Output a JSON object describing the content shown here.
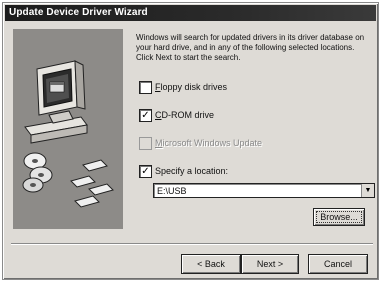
{
  "window": {
    "title": "Update Device Driver Wizard"
  },
  "intro_text": "Windows will search for updated drivers in its driver database on your hard drive, and in any of the following selected locations. Click Next to start the search.",
  "options": [
    {
      "label": "Floppy disk drives",
      "checked": false,
      "enabled": true
    },
    {
      "label": "CD-ROM drive",
      "checked": true,
      "enabled": true
    },
    {
      "label": "Microsoft Windows Update",
      "checked": false,
      "enabled": false
    },
    {
      "label": "Specify a location:",
      "checked": true,
      "enabled": true
    }
  ],
  "location": {
    "value": "E:\\USB"
  },
  "buttons": {
    "browse": "Browse...",
    "back": "< Back",
    "next": "Next >",
    "cancel": "Cancel"
  },
  "icons": {
    "check": "check-glyph",
    "dropdown": "down-arrow-glyph"
  }
}
